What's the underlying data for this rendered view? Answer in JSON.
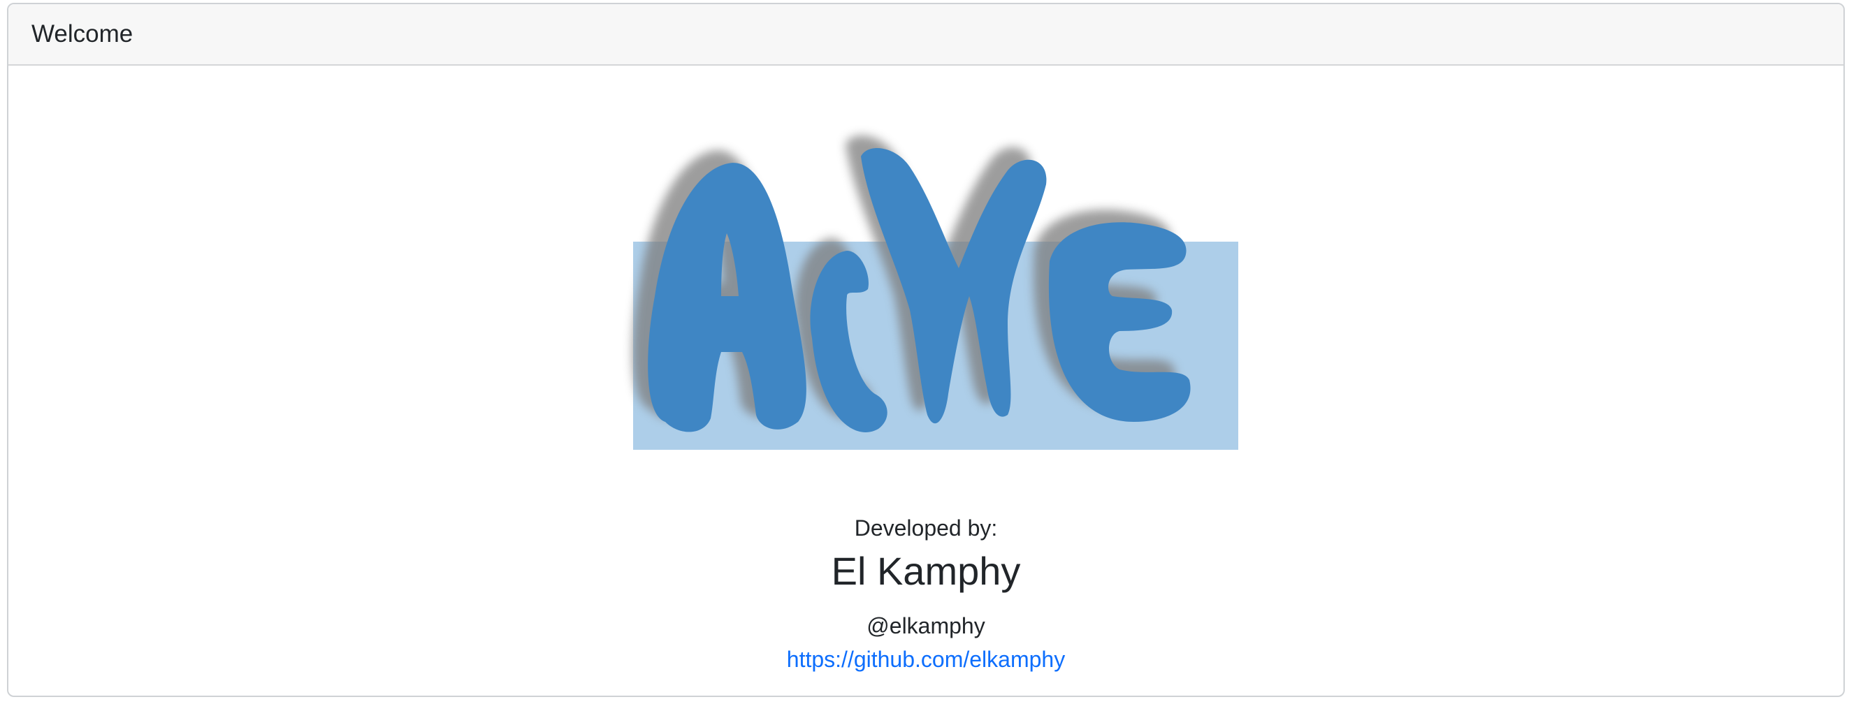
{
  "card": {
    "title": "Welcome"
  },
  "logo": {
    "text": "ACME",
    "icon": "acme-logo-icon",
    "colors": {
      "letters": "#3f86c4",
      "backdrop": "#a9cbe8",
      "shadow": "#8a8a8a"
    }
  },
  "credits": {
    "label": "Developed by:",
    "name": "El Kamphy",
    "handle": "@elkamphy",
    "link": "https://github.com/elkamphy"
  },
  "colors": {
    "link": "#0d6efd",
    "header_bg": "#f7f7f7",
    "border": "#cfd2d5"
  }
}
